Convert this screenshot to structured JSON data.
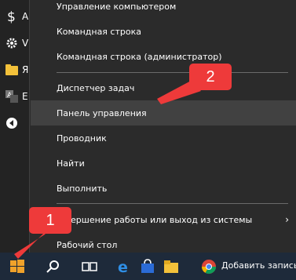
{
  "menu": {
    "items": [
      {
        "label": "Управление компьютером"
      },
      {
        "label": "Командная строка"
      },
      {
        "label": "Командная строка (администратор)"
      },
      {
        "label": "Диспетчер задач"
      },
      {
        "label": "Панель управления"
      },
      {
        "label": "Проводник"
      },
      {
        "label": "Найти"
      },
      {
        "label": "Выполнить"
      },
      {
        "label": "ершение работы или выход из системы"
      },
      {
        "label": "Рабочий стол"
      }
    ],
    "highlighted_item": "Панель управления"
  },
  "start_left": {
    "letters": [
      "А",
      "V",
      "Я",
      "Е"
    ]
  },
  "taskbar": {
    "app_title": "Добавить запись ‹"
  },
  "callouts": [
    {
      "label": "1"
    },
    {
      "label": "2"
    }
  ],
  "colors": {
    "accent_callout": "#ee3a3a",
    "menu_bg": "#2b2b2b",
    "menu_highlight": "#414141",
    "taskbar_bg": "#1e2a3a",
    "windows_logo": "#f0a22a"
  },
  "icons": {
    "left_strip": [
      "dollar-icon",
      "gear-icon",
      "folder-icon",
      "translate-icon",
      "media-back-icon"
    ],
    "taskbar": [
      "windows-start-icon",
      "search-icon",
      "task-view-icon",
      "edge-icon",
      "store-icon",
      "file-explorer-icon",
      "chrome-icon"
    ]
  }
}
